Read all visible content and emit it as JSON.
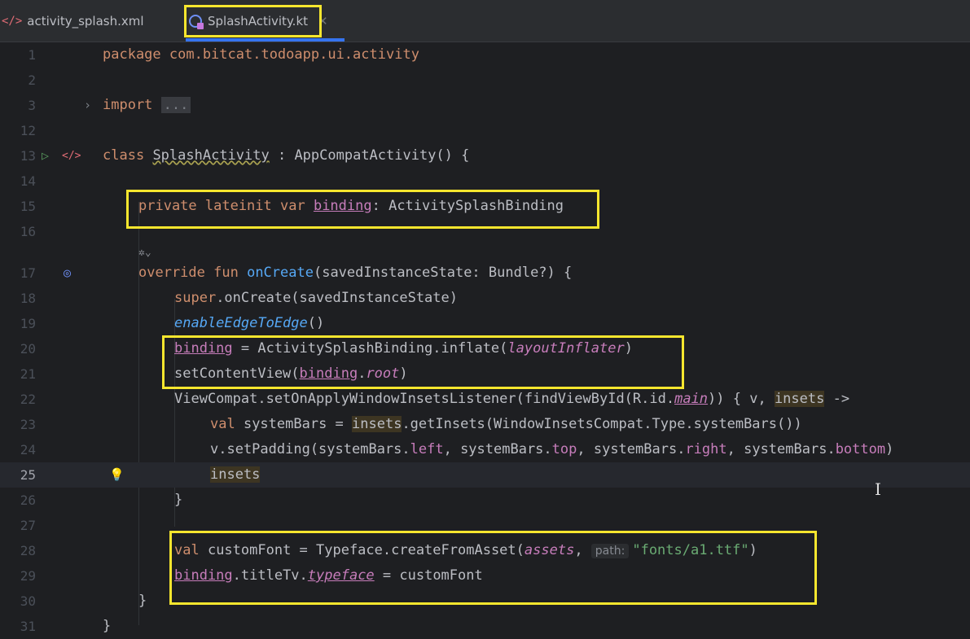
{
  "tabs": [
    {
      "label": "activity_splash.xml",
      "icon": "xml-file-icon",
      "active": false
    },
    {
      "label": "SplashActivity.kt",
      "icon": "kotlin-class-icon",
      "active": true
    }
  ],
  "colors": {
    "highlight_box": "#f7e62e",
    "active_tab_underline": "#3574f0",
    "editor_bg": "#1e1f22"
  },
  "gutter": {
    "run_icon": "run-gutter-icon",
    "layout_icon": "layout-gutter-icon",
    "override_icon": "override-gutter-icon",
    "bulb_icon": "lightbulb-icon",
    "fold_icon": "chevron-right-icon",
    "ai_icon": "ai-assistant-icon"
  },
  "editor": {
    "current_line": "25",
    "lines": [
      {
        "num": "1",
        "t": {
          "a": "package com.bitcat.todoapp.ui.activity"
        }
      },
      {
        "num": "2",
        "t": {}
      },
      {
        "num": "3",
        "t": {
          "a": "import",
          "b": "..."
        }
      },
      {
        "num": "12",
        "t": {}
      },
      {
        "num": "13",
        "t": {
          "a": "class",
          "b": "SplashActivity",
          "c": " : AppCompatActivity() {"
        }
      },
      {
        "num": "14",
        "t": {}
      },
      {
        "num": "15",
        "t": {
          "a": "private lateinit var",
          "b": "binding",
          "c": ": ActivitySplashBinding"
        }
      },
      {
        "num": "16",
        "t": {}
      },
      {
        "num": "17",
        "t": {
          "a": "override fun",
          "b": "onCreate",
          "c": "(savedInstanceState: Bundle?) {"
        }
      },
      {
        "num": "18",
        "t": {
          "a": "super",
          "b": ".onCreate(savedInstanceState)"
        }
      },
      {
        "num": "19",
        "t": {
          "a": "enableEdgeToEdge",
          "b": "()"
        }
      },
      {
        "num": "20",
        "t": {
          "a": "binding",
          "b": " = ActivitySplashBinding.inflate(",
          "c": "layoutInflater",
          "d": ")"
        }
      },
      {
        "num": "21",
        "t": {
          "a": "setContentView(",
          "b": "binding",
          "c": ".",
          "d": "root",
          "e": ")"
        }
      },
      {
        "num": "22",
        "t": {
          "a": "ViewCompat.setOnApplyWindowInsetsListener(findViewById(R.id.",
          "b": "main",
          "c": ")) { v, ",
          "d": "insets",
          "e": " ->"
        }
      },
      {
        "num": "23",
        "t": {
          "a": "val",
          "b": " systemBars = ",
          "c": "insets",
          "d": ".getInsets(WindowInsetsCompat.Type.systemBars())"
        }
      },
      {
        "num": "24",
        "t": {
          "a": "v.setPadding(systemBars.",
          "b": "left",
          "c": ", systemBars.",
          "d": "top",
          "e": ", systemBars.",
          "f": "right",
          "g": ", systemBars.",
          "h": "bottom",
          "i": ")"
        }
      },
      {
        "num": "25",
        "t": {
          "a": "insets"
        }
      },
      {
        "num": "26",
        "t": {
          "a": "}"
        }
      },
      {
        "num": "27",
        "t": {}
      },
      {
        "num": "28",
        "t": {
          "a": "val",
          "b": " customFont = Typeface.createFromAsset(",
          "c": "assets",
          "d": ", ",
          "e": "path:",
          "f": "\"fonts/a1.ttf\"",
          "g": ")"
        }
      },
      {
        "num": "29",
        "t": {
          "a": "binding",
          "b": ".titleTv.",
          "c": "typeface",
          "d": " = customFont"
        }
      },
      {
        "num": "30",
        "t": {
          "a": "}"
        }
      },
      {
        "num": "31",
        "t": {
          "a": "}"
        }
      }
    ]
  }
}
